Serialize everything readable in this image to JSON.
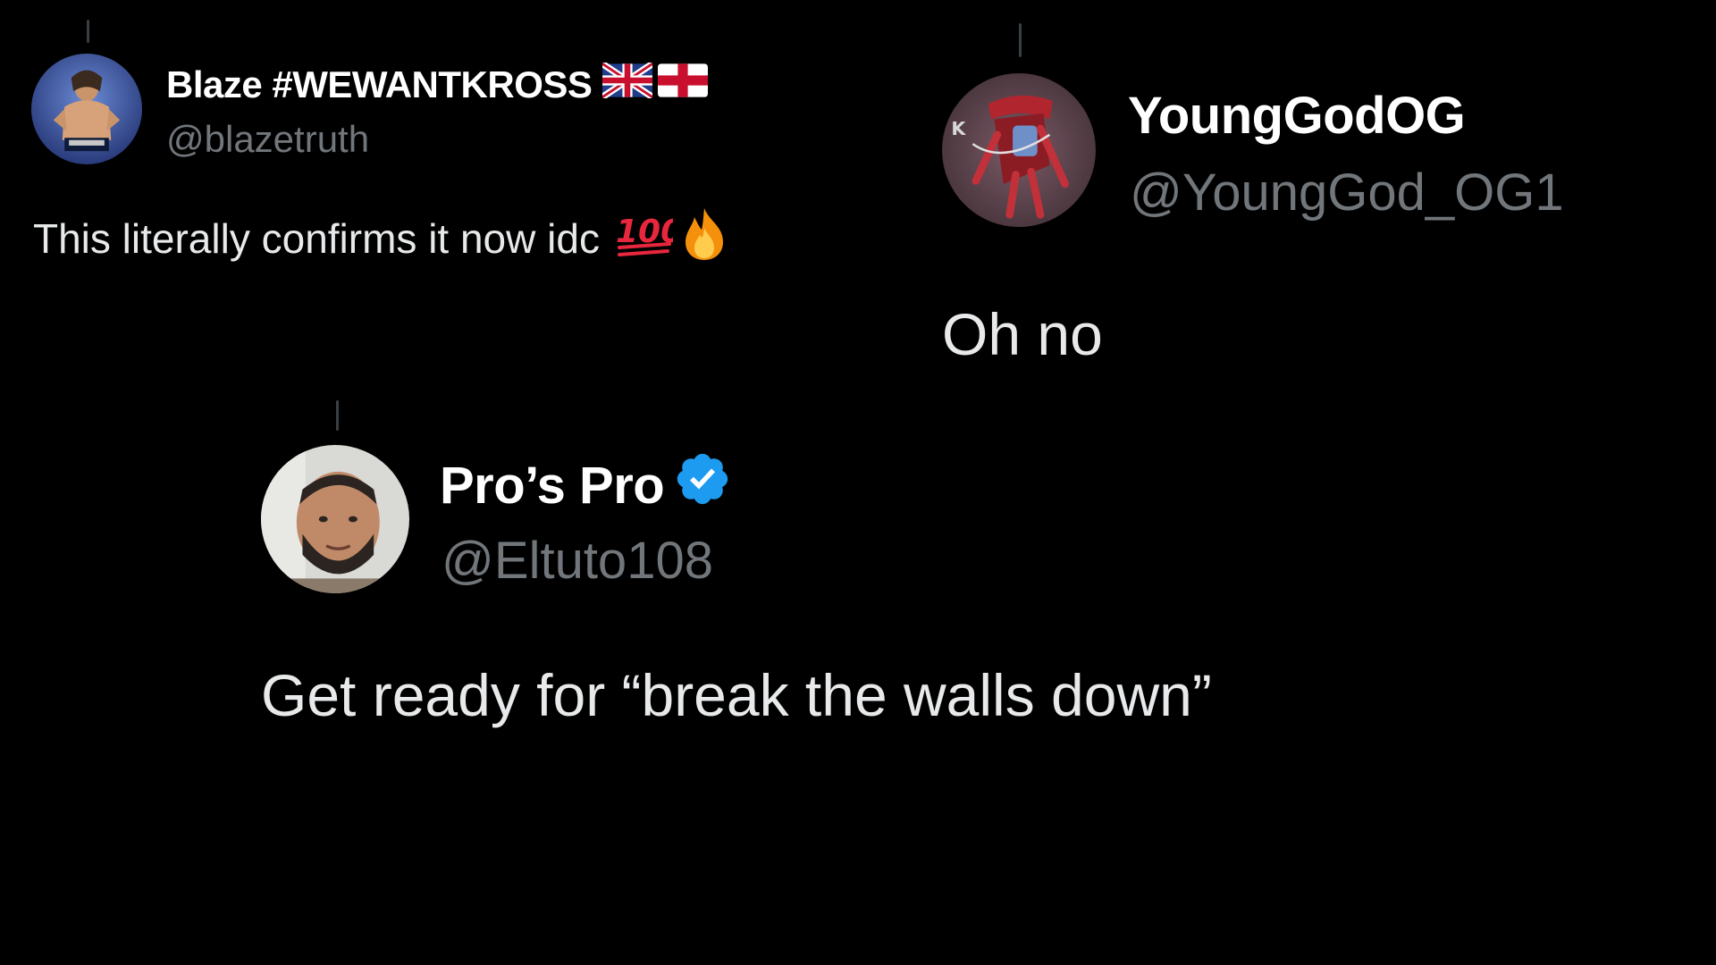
{
  "posts": [
    {
      "display_name": "Blaze #WEWANTKROSS",
      "name_flags": [
        "union-jack-flag-icon",
        "england-flag-icon"
      ],
      "handle": "@blazetruth",
      "text": "This literally confirms it now idc",
      "text_emojis": [
        "hundred-points-icon",
        "fire-icon"
      ]
    },
    {
      "display_name": "YoungGodOG",
      "handle": "@YoungGod_OG1",
      "text": "Oh no"
    },
    {
      "display_name": "Pro’s Pro",
      "verified": true,
      "handle": "@Eltuto108",
      "text": "Get ready for “break the walls down”"
    }
  ],
  "colors": {
    "background": "#000000",
    "name": "#ffffff",
    "handle": "#71767b",
    "body_text": "#e7e9ea",
    "verified_badge": "#1d9bf0"
  }
}
